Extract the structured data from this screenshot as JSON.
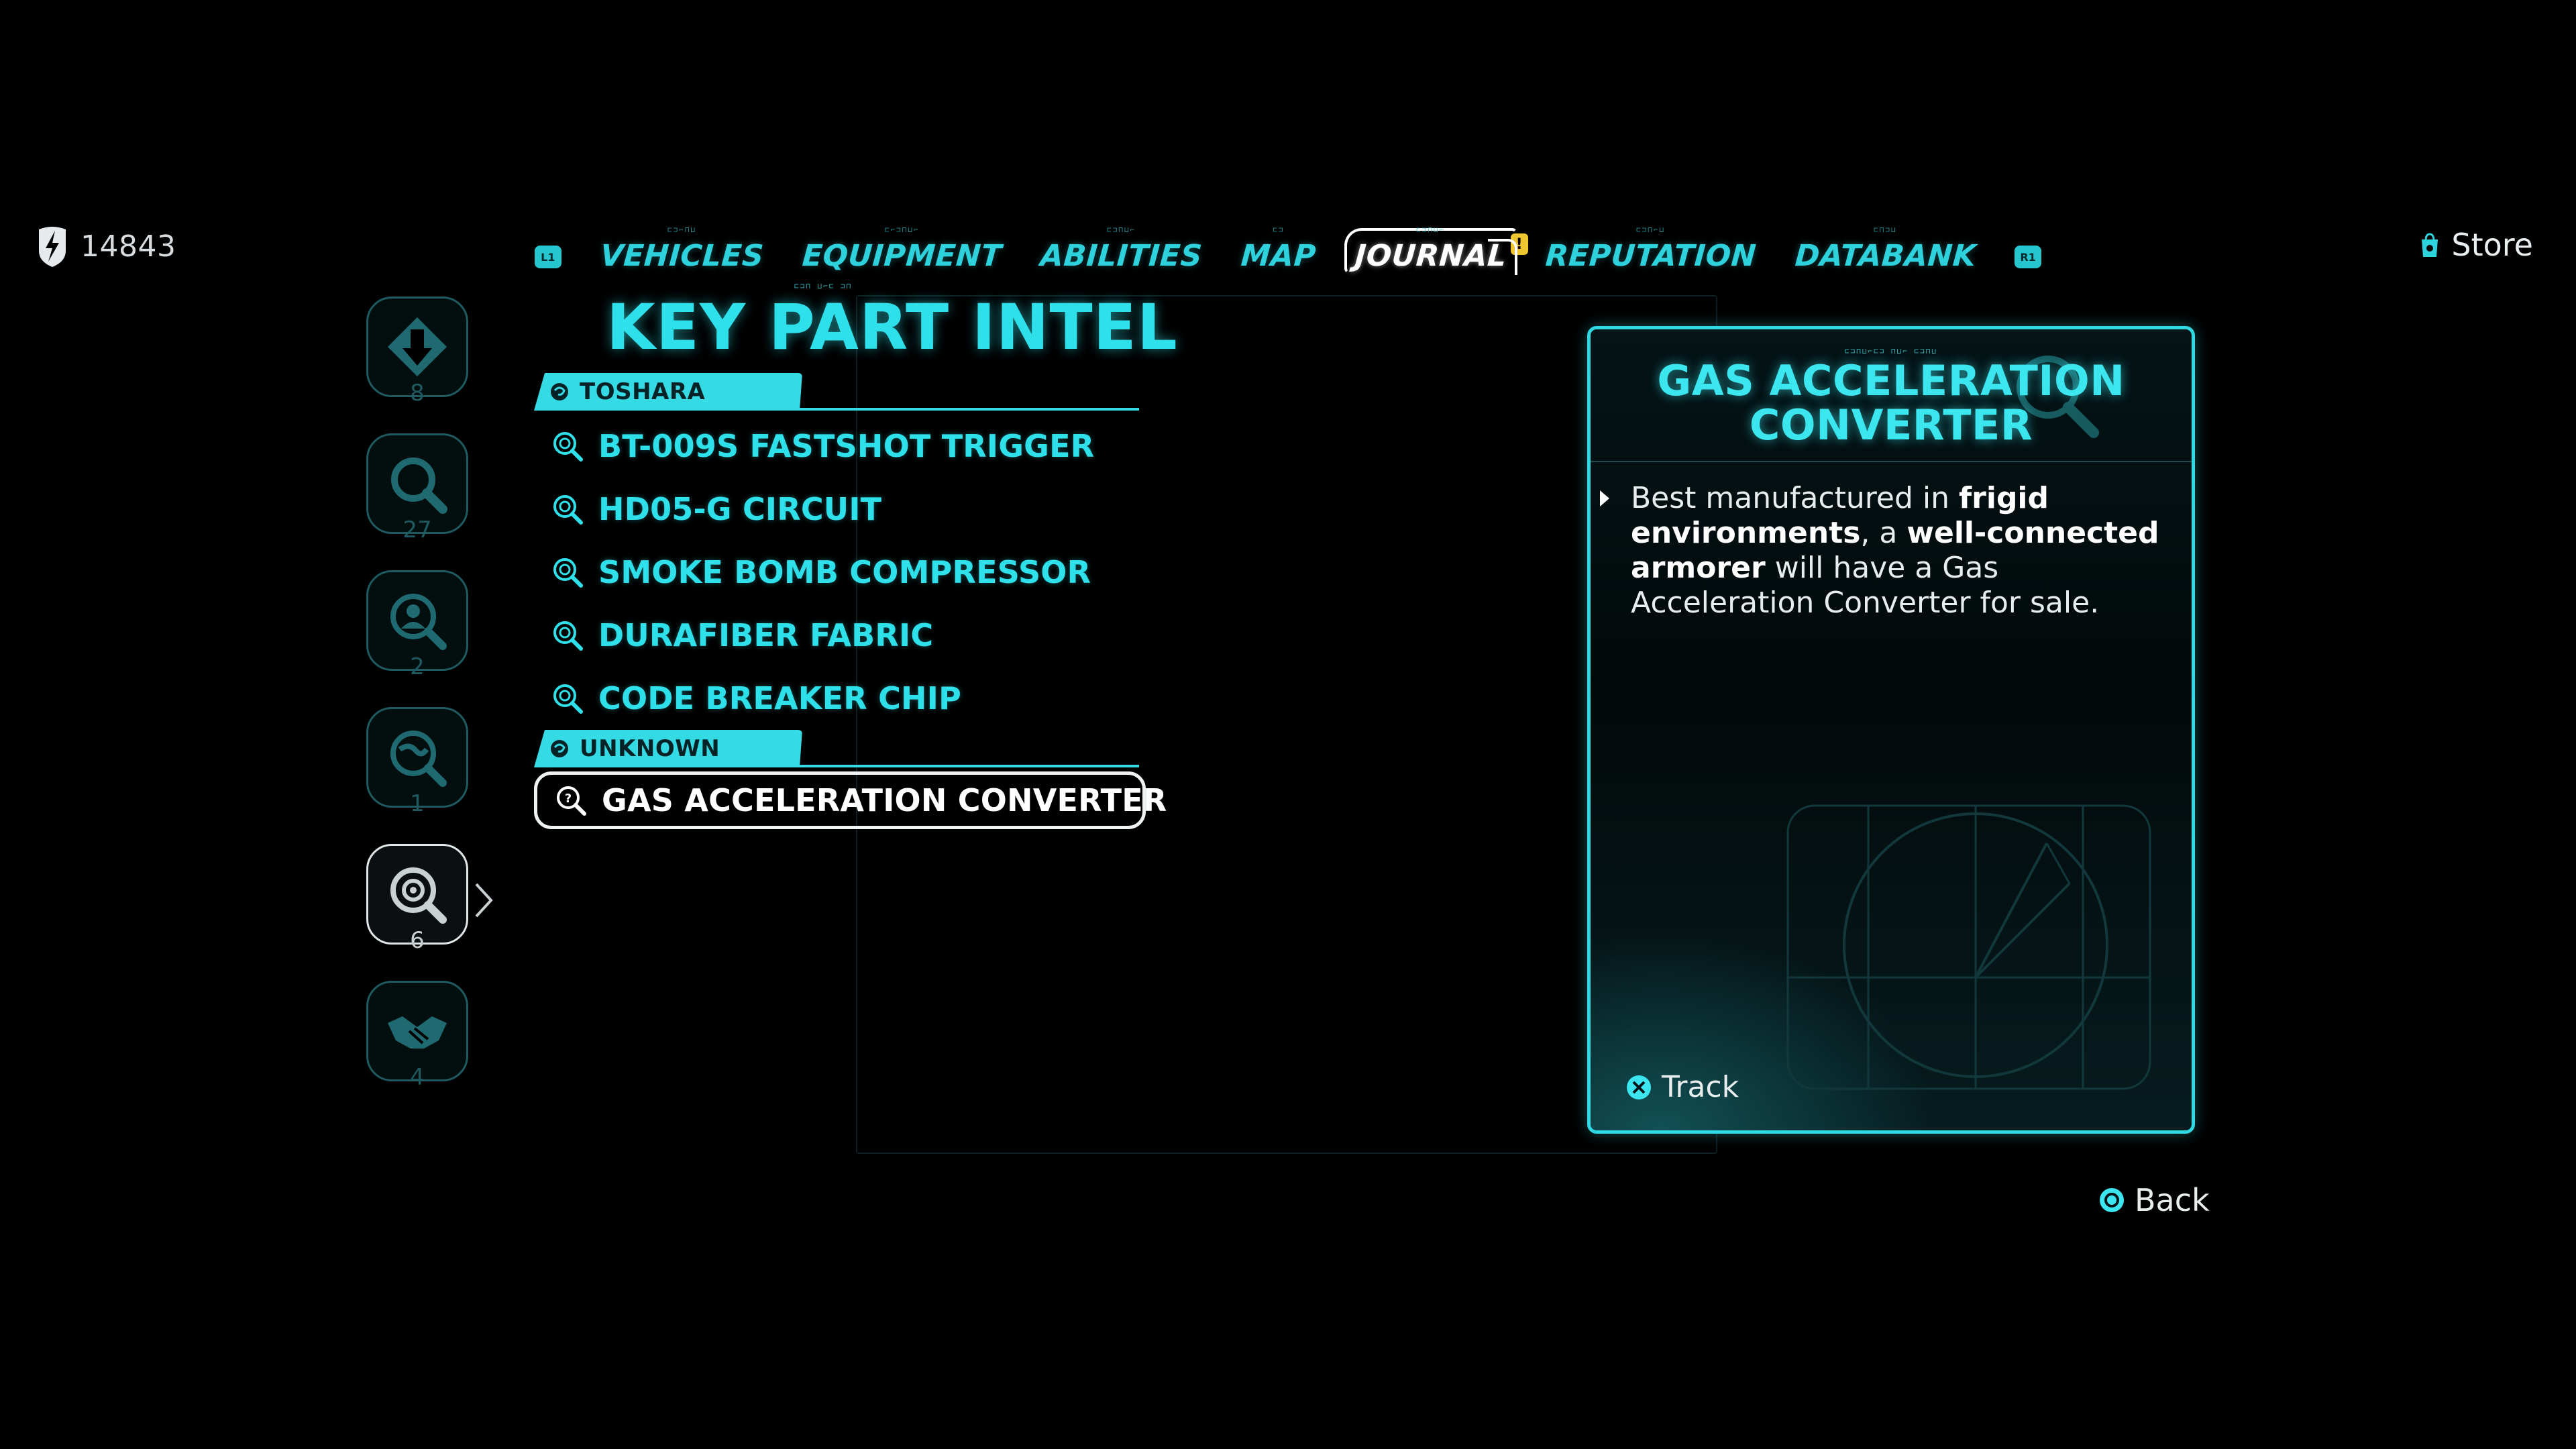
{
  "currency": {
    "amount": "14843",
    "icon": "bolt-badge-icon"
  },
  "nav": {
    "left_bumper": "L1",
    "right_bumper": "R1",
    "tabs": [
      {
        "label": "VEHICLES"
      },
      {
        "label": "EQUIPMENT"
      },
      {
        "label": "ABILITIES"
      },
      {
        "label": "MAP"
      },
      {
        "label": "JOURNAL",
        "active": true,
        "alert": "!"
      },
      {
        "label": "REPUTATION"
      },
      {
        "label": "DATABANK"
      }
    ],
    "store_label": "Store"
  },
  "rail": {
    "items": [
      {
        "icon": "down-arrow-icon",
        "count": "8"
      },
      {
        "icon": "search-icon",
        "count": "27"
      },
      {
        "icon": "person-search-icon",
        "count": "2"
      },
      {
        "icon": "globe-search-icon",
        "count": "1"
      },
      {
        "icon": "part-search-icon",
        "count": "6",
        "active": true
      },
      {
        "icon": "handshake-icon",
        "count": "4"
      }
    ]
  },
  "list": {
    "title": "KEY PART INTEL",
    "groups": [
      {
        "name": "TOSHARA",
        "items": [
          "BT-009S FASTSHOT TRIGGER",
          "HD05-G CIRCUIT",
          "SMOKE BOMB COMPRESSOR",
          "DURAFIBER FABRIC",
          "CODE BREAKER CHIP"
        ]
      },
      {
        "name": "UNKNOWN",
        "items": [
          "GAS ACCELERATION CONVERTER"
        ]
      }
    ]
  },
  "detail": {
    "title_line1": "GAS ACCELERATION",
    "title_line2": "CONVERTER",
    "body": {
      "t1": "Best manufactured in ",
      "b1": "frigid environments",
      "t2": ", a ",
      "b2": "well-connected armorer",
      "t3": " will have a Gas Acceleration Converter for sale."
    },
    "track_label": "Track"
  },
  "back_label": "Back",
  "colors": {
    "accent": "#2ee0ea",
    "panel_border": "#30d9e3",
    "alert": "#f0c630"
  }
}
